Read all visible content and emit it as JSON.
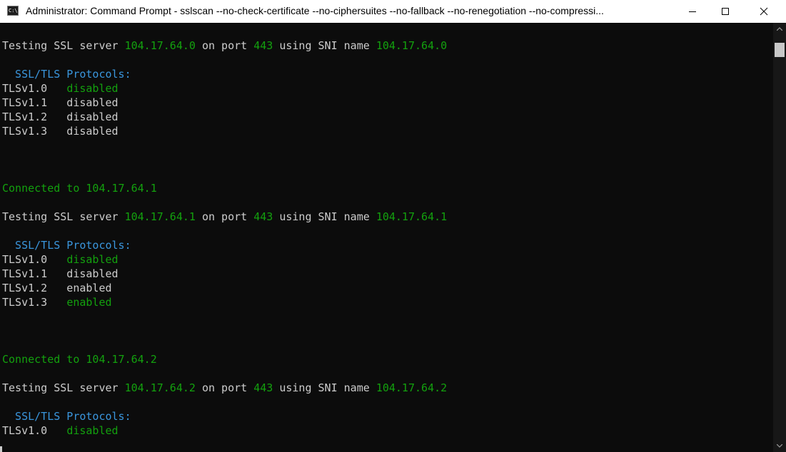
{
  "window": {
    "title": "Administrator: Command Prompt - sslscan  --no-check-certificate --no-ciphersuites --no-fallback --no-renegotiation --no-compressi..."
  },
  "icons": {
    "app": "cmd-icon",
    "app_glyph": "C:\\",
    "minimize": "minimize-icon",
    "maximize": "maximize-icon",
    "close": "close-icon"
  },
  "colors": {
    "background": "#0c0c0c",
    "text": "#cccccc",
    "green": "#13a10e",
    "cyan": "#3a96dd"
  },
  "lines": [
    [
      {
        "t": "Testing SSL server ",
        "c": "#cccccc"
      },
      {
        "t": "104.17.64.0",
        "c": "#13a10e"
      },
      {
        "t": " on port ",
        "c": "#cccccc"
      },
      {
        "t": "443",
        "c": "#13a10e"
      },
      {
        "t": " using SNI name ",
        "c": "#cccccc"
      },
      {
        "t": "104.17.64.0",
        "c": "#13a10e"
      }
    ],
    [],
    [
      {
        "t": "  SSL/TLS Protocols:",
        "c": "#3a96dd"
      }
    ],
    [
      {
        "t": "TLSv1.0   ",
        "c": "#cccccc"
      },
      {
        "t": "disabled",
        "c": "#13a10e"
      }
    ],
    [
      {
        "t": "TLSv1.1   disabled",
        "c": "#cccccc"
      }
    ],
    [
      {
        "t": "TLSv1.2   disabled",
        "c": "#cccccc"
      }
    ],
    [
      {
        "t": "TLSv1.3   disabled",
        "c": "#cccccc"
      }
    ],
    [],
    [],
    [],
    [
      {
        "t": "Connected to 104.17.64.1",
        "c": "#13a10e"
      }
    ],
    [],
    [
      {
        "t": "Testing SSL server ",
        "c": "#cccccc"
      },
      {
        "t": "104.17.64.1",
        "c": "#13a10e"
      },
      {
        "t": " on port ",
        "c": "#cccccc"
      },
      {
        "t": "443",
        "c": "#13a10e"
      },
      {
        "t": " using SNI name ",
        "c": "#cccccc"
      },
      {
        "t": "104.17.64.1",
        "c": "#13a10e"
      }
    ],
    [],
    [
      {
        "t": "  SSL/TLS Protocols:",
        "c": "#3a96dd"
      }
    ],
    [
      {
        "t": "TLSv1.0   ",
        "c": "#cccccc"
      },
      {
        "t": "disabled",
        "c": "#13a10e"
      }
    ],
    [
      {
        "t": "TLSv1.1   disabled",
        "c": "#cccccc"
      }
    ],
    [
      {
        "t": "TLSv1.2   enabled",
        "c": "#cccccc"
      }
    ],
    [
      {
        "t": "TLSv1.3   ",
        "c": "#cccccc"
      },
      {
        "t": "enabled",
        "c": "#13a10e"
      }
    ],
    [],
    [],
    [],
    [
      {
        "t": "Connected to 104.17.64.2",
        "c": "#13a10e"
      }
    ],
    [],
    [
      {
        "t": "Testing SSL server ",
        "c": "#cccccc"
      },
      {
        "t": "104.17.64.2",
        "c": "#13a10e"
      },
      {
        "t": " on port ",
        "c": "#cccccc"
      },
      {
        "t": "443",
        "c": "#13a10e"
      },
      {
        "t": " using SNI name ",
        "c": "#cccccc"
      },
      {
        "t": "104.17.64.2",
        "c": "#13a10e"
      }
    ],
    [],
    [
      {
        "t": "  SSL/TLS Protocols:",
        "c": "#3a96dd"
      }
    ],
    [
      {
        "t": "TLSv1.0   ",
        "c": "#cccccc"
      },
      {
        "t": "disabled",
        "c": "#13a10e"
      }
    ]
  ]
}
